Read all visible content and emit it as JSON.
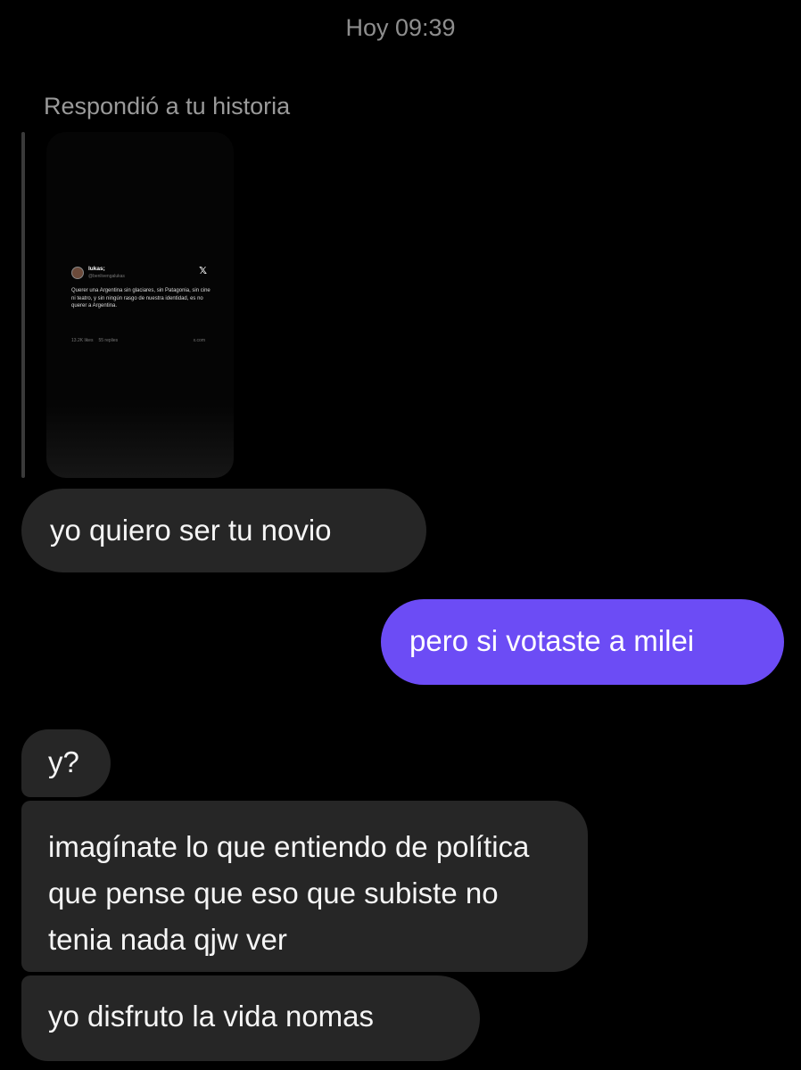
{
  "header": {
    "timestamp": "Hoy 09:39"
  },
  "story_reply": {
    "label": "Respondió a tu historia",
    "tweet": {
      "name": "lukas;",
      "handle": "@benlivengalukas",
      "text": "Querer una Argentina sin glaciares, sin Patagonia, sin cine ni teatro, y sin ningún rasgo de nuestra identidad, es no querer a Argentina.",
      "likes": "13.2K likes",
      "replies": "55 replies",
      "source": "x.com",
      "logo": "x-logo"
    }
  },
  "messages": [
    {
      "direction": "received",
      "text": "yo quiero ser tu novio"
    },
    {
      "direction": "sent",
      "text": "pero si votaste a milei"
    },
    {
      "direction": "received",
      "text": "y?"
    },
    {
      "direction": "received",
      "text": "imagínate lo que entiendo de política que pense que eso que subiste no tenia nada qjw ver"
    },
    {
      "direction": "received",
      "text": "yo disfruto la vida nomas"
    }
  ],
  "colors": {
    "background": "#000000",
    "received_bubble": "#262626",
    "sent_bubble": "#6c4cf5",
    "secondary_text": "#8e8e8e"
  }
}
